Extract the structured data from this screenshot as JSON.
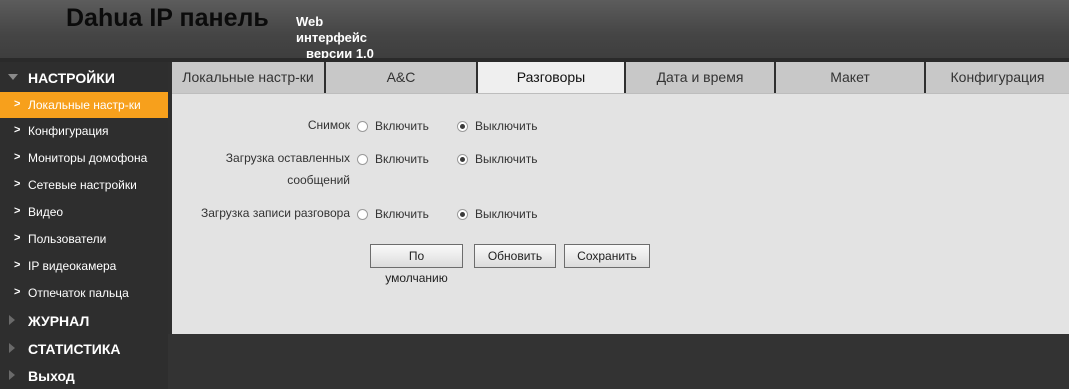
{
  "header": {
    "brand": "Dahua IP панель",
    "subtitle_line1": "Web интерфейс",
    "subtitle_line2": "версии 1.0"
  },
  "sidebar": {
    "settings_label": "НАСТРОЙКИ",
    "items": [
      {
        "label": "Локальные настр-ки"
      },
      {
        "label": "Конфигурация"
      },
      {
        "label": "Мониторы домофона"
      },
      {
        "label": "Сетевые настройки"
      },
      {
        "label": "Видео"
      },
      {
        "label": "Пользователи"
      },
      {
        "label": "IP видеокамера"
      },
      {
        "label": "Отпечаток пальца"
      }
    ],
    "journal_label": "ЖУРНАЛ",
    "stats_label": "СТАТИСТИКА",
    "exit_label": "Выход"
  },
  "tabs": [
    {
      "label": "Локальные настр-ки"
    },
    {
      "label": "A&C"
    },
    {
      "label": "Разговоры"
    },
    {
      "label": "Дата и время"
    },
    {
      "label": "Макет"
    },
    {
      "label": "Конфигурация"
    }
  ],
  "form": {
    "snapshot_label": "Снимок",
    "messages_label_line1": "Загрузка оставленных",
    "messages_label_line2": "сообщений",
    "record_label": "Загрузка записи разговора",
    "enable": "Включить",
    "disable": "Выключить"
  },
  "buttons": {
    "default": "По умолчанию",
    "refresh": "Обновить",
    "save": "Сохранить"
  },
  "colors": {
    "accent": "#f7a01c",
    "sidebar_bg": "#2e2e2e",
    "content_bg": "#e3e3e3"
  }
}
